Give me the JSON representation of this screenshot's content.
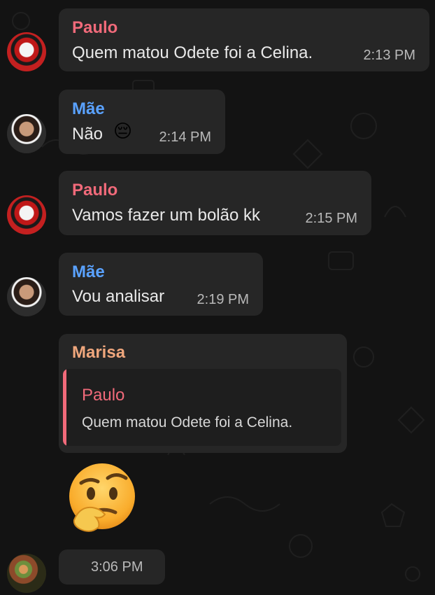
{
  "colors": {
    "background": "#131313",
    "bubble": "#262626",
    "quote_bg": "#1e1e1e",
    "paulo": "#f16a7a",
    "mae": "#5aa2ff",
    "marisa": "#f0a77d"
  },
  "messages": [
    {
      "sender": "Paulo",
      "text": "Quem matou Odete foi a Celina.",
      "time": "2:13 PM",
      "avatar": "avatar-paulo"
    },
    {
      "sender": "Mãe",
      "text": "Não",
      "emoji": "😔",
      "time": "2:14 PM",
      "avatar": "avatar-mae"
    },
    {
      "sender": "Paulo",
      "text": "Vamos fazer um bolão kk",
      "time": "2:15 PM",
      "avatar": "avatar-paulo"
    },
    {
      "sender": "Mãe",
      "text": "Vou analisar",
      "time": "2:19 PM",
      "avatar": "avatar-mae"
    },
    {
      "sender": "Marisa",
      "quote": {
        "sender": "Paulo",
        "text": "Quem matou Odete foi a Celina."
      },
      "emoji": "🤔",
      "time": "3:06 PM",
      "avatar": "avatar-marisa"
    }
  ]
}
